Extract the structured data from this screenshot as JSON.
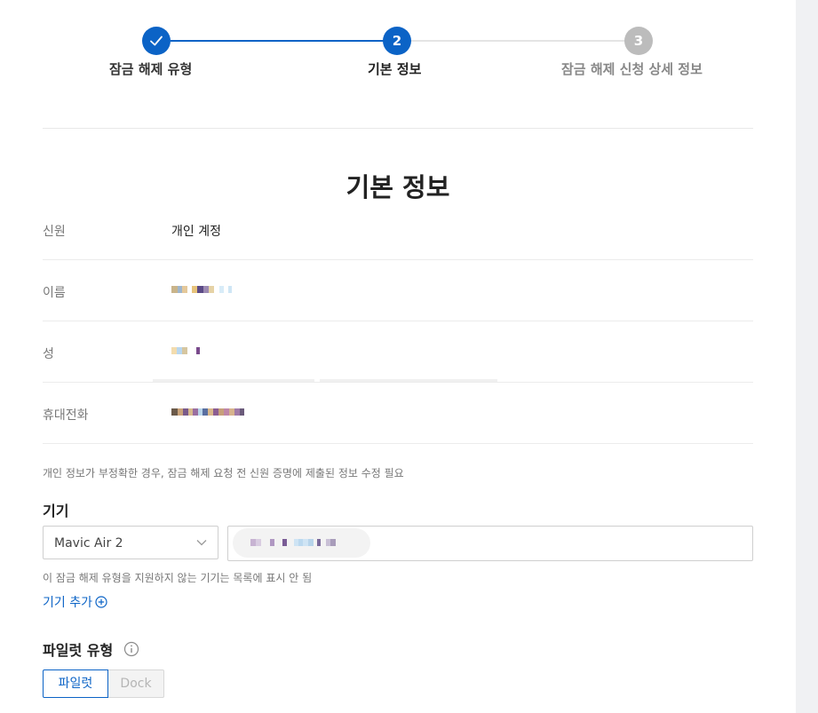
{
  "stepper": {
    "steps": [
      {
        "number": "",
        "label": "잠금 해제 유형",
        "state": "done",
        "icon": "check-icon"
      },
      {
        "number": "2",
        "label": "기본 정보",
        "state": "active"
      },
      {
        "number": "3",
        "label": "잠금 해제 신청 상세 정보",
        "state": "todo"
      }
    ]
  },
  "section_title": "기본 정보",
  "info": {
    "rows": [
      {
        "label": "신원",
        "value": "개인 계정"
      },
      {
        "label": "이름",
        "value": ""
      },
      {
        "label": "성",
        "value": ""
      },
      {
        "label": "휴대전화",
        "value": ""
      }
    ]
  },
  "notice": "개인 정보가 부정확한 경우, 잠금 해제 요청 전 신원 증명에 제출된 정보 수정 필요",
  "device": {
    "heading": "기기",
    "selected_model": "Mavic Air 2",
    "hint": "이 잠금 해제 유형을 지원하지 않는 기기는 목록에 표시 안 됨",
    "add_label": "기기 추가",
    "add_icon": "plus-circle-icon"
  },
  "pilot": {
    "heading": "파일럿 유형",
    "info_icon": "info-icon",
    "options": [
      "파일럿",
      "Dock"
    ],
    "selected": "파일럿"
  },
  "colors": {
    "accent": "#0b63c6",
    "inactive_step": "#bcbcbc"
  }
}
